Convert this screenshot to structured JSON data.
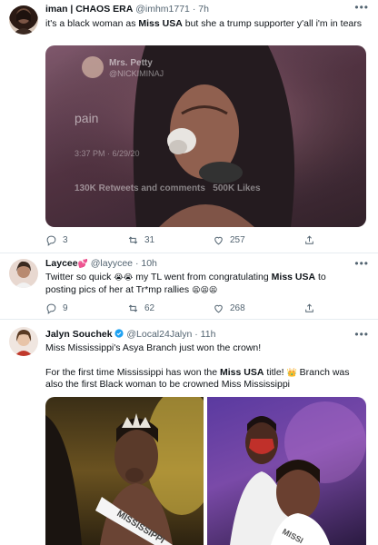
{
  "tweets": [
    {
      "name": "iman | CHAOS ERA",
      "handle": "@imhm1771",
      "sep": "·",
      "time": "7h",
      "text_pre": "it's a black woman as ",
      "text_bold": "Miss USA",
      "text_post": " but she a trump supporter y'all i'm in tears",
      "media": {
        "account_name": "Mrs. Petty",
        "account_handle": "@NICKIMINAJ",
        "tweet_text": "pain",
        "time_text": "3:37 PM · 6/29/20",
        "stats": "130K Retweets and comments   500K Likes"
      },
      "replies": "3",
      "retweets": "31",
      "likes": "257"
    },
    {
      "name": "Laycee",
      "name_emoji": "💕",
      "handle": "@layycee",
      "sep": "·",
      "time": "10h",
      "line1_pre": "Twitter so quick ",
      "line1_emoji": "😭😭",
      "line1_mid": " my TL went from congratulating ",
      "line1_bold": "Miss USA",
      "line1_post": " to",
      "line2_pre": "posting pics of her at Tr*mp rallies ",
      "line2_emoji": "😫😫😫",
      "replies": "9",
      "retweets": "62",
      "likes": "268"
    },
    {
      "name": "Jalyn Souchek",
      "handle": "@Local24Jalyn",
      "sep": "·",
      "time": "11h",
      "para1": "Miss Mississippi's Asya Branch just won the crown!",
      "para2_pre": "For the first time Mississippi has won the ",
      "para2_bold": "Miss USA",
      "para2_mid": " title! ",
      "para2_emoji": "👑",
      "para2_post": " Branch was also the first Black woman to be crowned Miss Mississippi",
      "sash_left": "MISSISSIPPI",
      "sash_right": "MISSI"
    }
  ],
  "colors": {
    "accent": "#1da1f2",
    "muted": "#536471",
    "divider": "#e6ecf0"
  },
  "icons": {
    "more": "more-horizontal-icon",
    "reply": "reply-icon",
    "retweet": "retweet-icon",
    "like": "heart-icon",
    "share": "share-icon",
    "verified": "verified-badge-icon"
  }
}
